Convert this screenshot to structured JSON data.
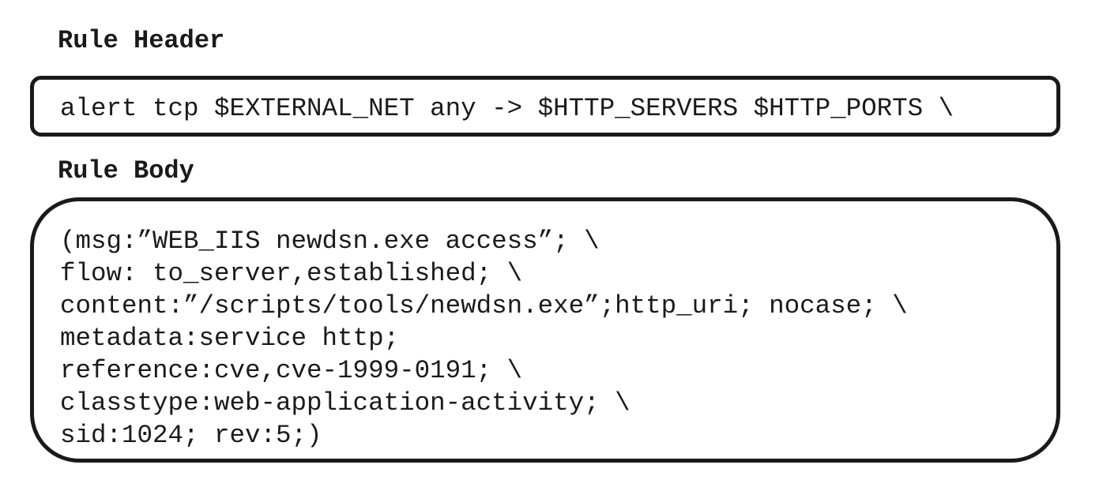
{
  "rule_header": {
    "title": "Rule Header",
    "code": "alert tcp $EXTERNAL_NET any -> $HTTP_SERVERS $HTTP_PORTS \\"
  },
  "rule_body": {
    "title": "Rule Body",
    "lines": [
      "(msg:”WEB_IIS newdsn.exe access”; \\",
      "flow: to_server,established; \\",
      "content:”/scripts/tools/newdsn.exe”;http_uri; nocase; \\",
      "metadata:service http;",
      "reference:cve,cve-1999-0191; \\",
      "classtype:web-application-activity; \\",
      "sid:1024; rev:5;)"
    ]
  }
}
